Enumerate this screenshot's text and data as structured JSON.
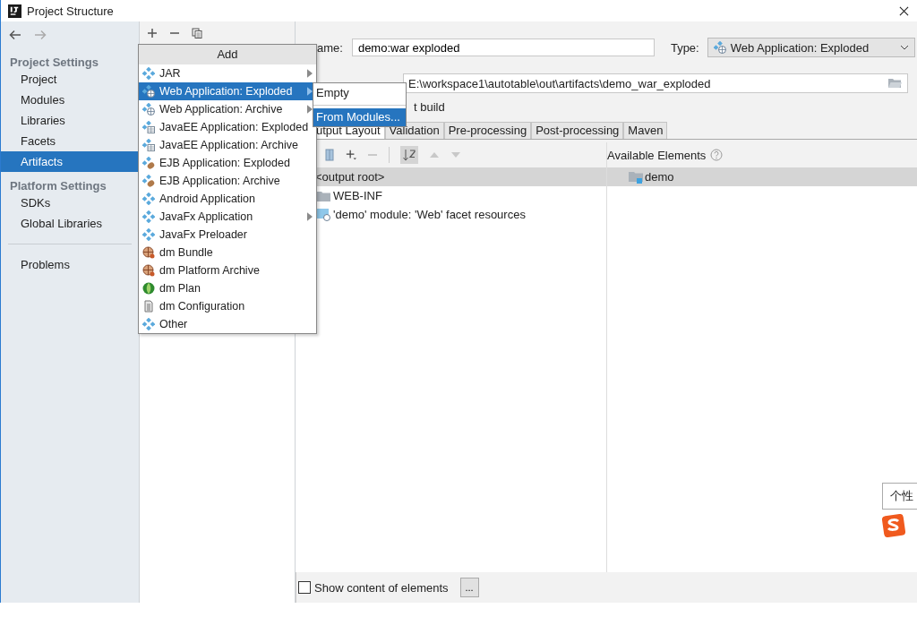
{
  "window": {
    "title": "Project Structure"
  },
  "sidebar": {
    "sections": [
      {
        "title": "Project Settings",
        "items": [
          {
            "label": "Project",
            "selected": false
          },
          {
            "label": "Modules",
            "selected": false
          },
          {
            "label": "Libraries",
            "selected": false
          },
          {
            "label": "Facets",
            "selected": false
          },
          {
            "label": "Artifacts",
            "selected": true
          }
        ]
      },
      {
        "title": "Platform Settings",
        "items": [
          {
            "label": "SDKs",
            "selected": false
          },
          {
            "label": "Global Libraries",
            "selected": false
          }
        ]
      }
    ],
    "footer_items": [
      {
        "label": "Problems",
        "selected": false
      }
    ]
  },
  "artifact": {
    "name_label": "ame:",
    "name": "demo:war exploded",
    "type_label": "Type:",
    "type": "Web Application: Exploded",
    "output_directory": "E:\\workspace1\\autotable\\out\\artifacts\\demo_war_exploded",
    "build_label": "t build"
  },
  "tabs": [
    {
      "label": "utput Layout",
      "selected": true
    },
    {
      "label": "Validation",
      "selected": false
    },
    {
      "label": "Pre-processing",
      "selected": false
    },
    {
      "label": "Post-processing",
      "selected": false
    },
    {
      "label": "Maven",
      "selected": false
    }
  ],
  "layout_tree": {
    "root": {
      "label": "<output root>",
      "selected": true
    },
    "children": [
      {
        "label": "WEB-INF",
        "kind": "folder"
      },
      {
        "label": "'demo' module: 'Web' facet resources",
        "kind": "module"
      }
    ]
  },
  "available": {
    "title": "Available Elements",
    "items": [
      {
        "label": "demo",
        "selected": true
      }
    ]
  },
  "show_content": {
    "label": "Show content of elements",
    "checked": false
  },
  "more_button": "...",
  "add_menu": {
    "title": "Add",
    "items": [
      {
        "label": "JAR",
        "kind": "diamond",
        "submenu": true,
        "selected": false
      },
      {
        "label": "Web Application: Exploded",
        "kind": "web",
        "submenu": true,
        "selected": true
      },
      {
        "label": "Web Application: Archive",
        "kind": "web",
        "submenu": true,
        "selected": false
      },
      {
        "label": "JavaEE Application: Exploded",
        "kind": "javaee",
        "submenu": false,
        "selected": false
      },
      {
        "label": "JavaEE Application: Archive",
        "kind": "javaee",
        "submenu": false,
        "selected": false
      },
      {
        "label": "EJB Application: Exploded",
        "kind": "ejb",
        "submenu": false,
        "selected": false
      },
      {
        "label": "EJB Application: Archive",
        "kind": "ejb",
        "submenu": false,
        "selected": false
      },
      {
        "label": "Android Application",
        "kind": "diamond",
        "submenu": false,
        "selected": false
      },
      {
        "label": "JavaFx Application",
        "kind": "diamond",
        "submenu": true,
        "selected": false
      },
      {
        "label": "JavaFx Preloader",
        "kind": "diamond",
        "submenu": false,
        "selected": false
      },
      {
        "label": "dm Bundle",
        "kind": "bundle",
        "submenu": false,
        "selected": false
      },
      {
        "label": "dm Platform Archive",
        "kind": "bundle",
        "submenu": false,
        "selected": false
      },
      {
        "label": "dm Plan",
        "kind": "plan",
        "submenu": false,
        "selected": false
      },
      {
        "label": "dm Configuration",
        "kind": "config",
        "submenu": false,
        "selected": false
      },
      {
        "label": "Other",
        "kind": "diamond",
        "submenu": false,
        "selected": false
      }
    ]
  },
  "submenu": {
    "items": [
      {
        "label": "Empty",
        "selected": false
      },
      {
        "label": "From Modules...",
        "selected": true
      }
    ]
  },
  "ime": {
    "tooltip": "个性"
  }
}
